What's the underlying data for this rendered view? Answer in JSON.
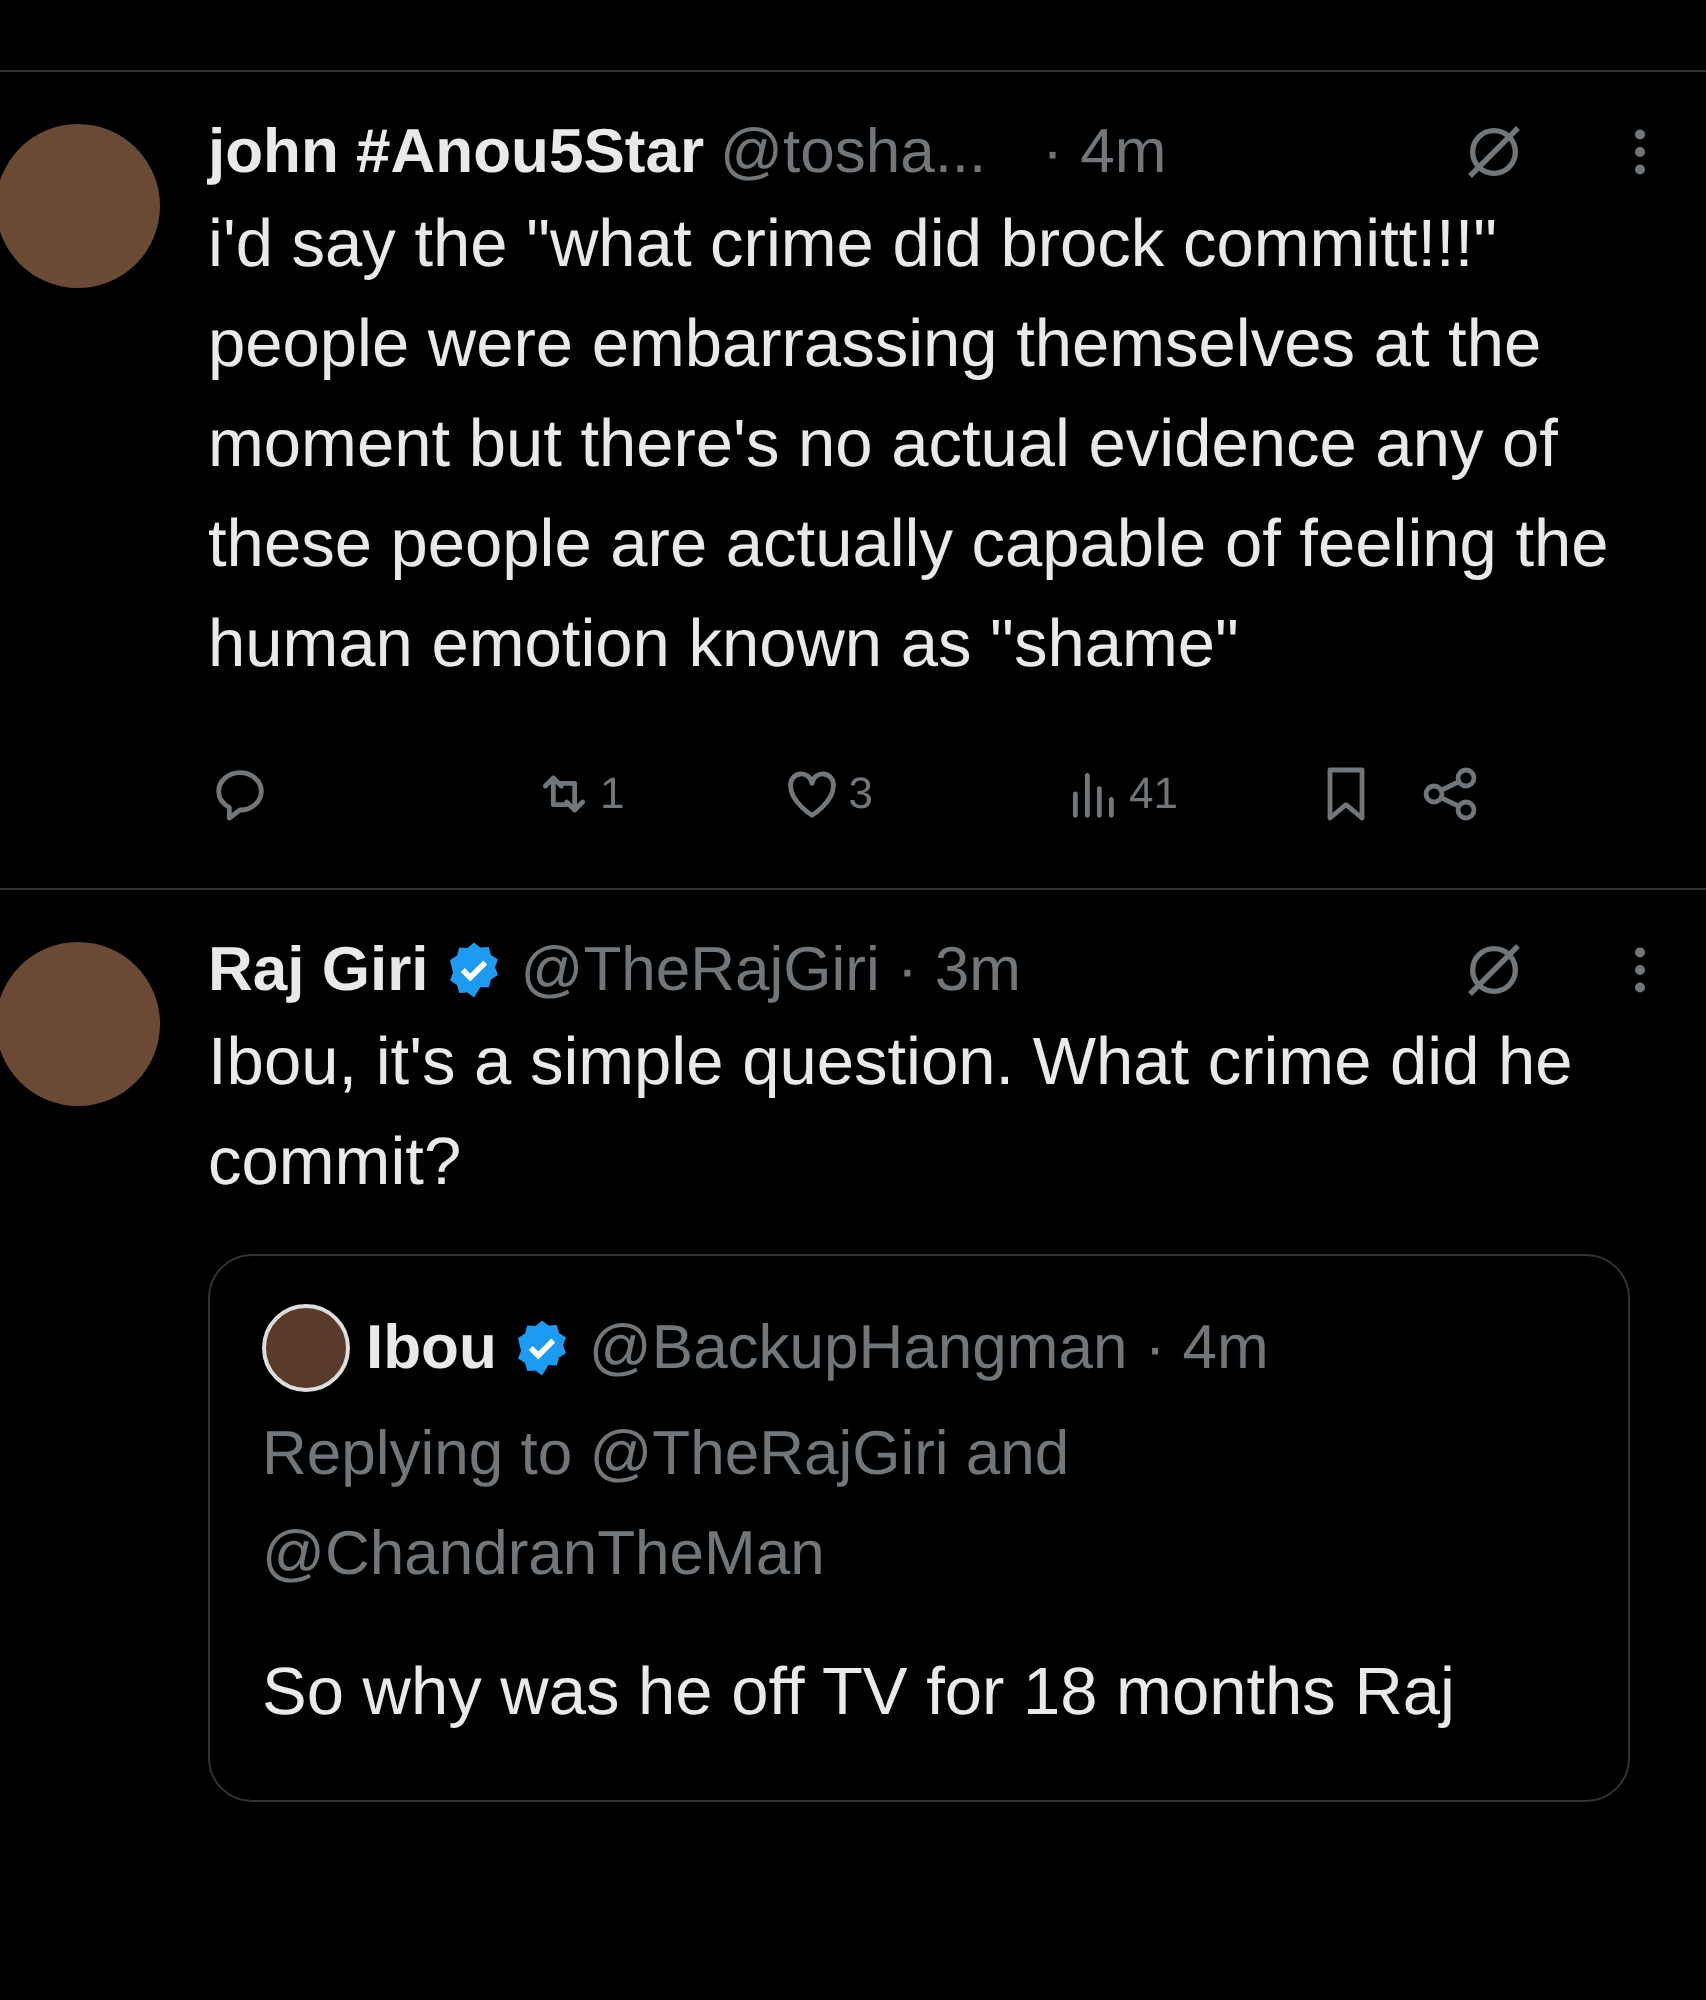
{
  "tweets": [
    {
      "name": "john #Anou5Star",
      "verified": false,
      "handle": "@tosha...",
      "time": "· 4m",
      "text": "i'd say the \"what crime did brock committ!!!\" people were embarrassing themselves at the moment but there's no actual evidence any of these people are actually capable of feeling the human emotion known as \"shame\"",
      "actions": [
        {
          "kind": "reply"
        },
        {
          "kind": "repost",
          "count": "1"
        },
        {
          "kind": "like",
          "count": "3"
        },
        {
          "kind": "views",
          "count": "41"
        },
        {
          "kind": "bookmark"
        },
        {
          "kind": "share"
        }
      ]
    },
    {
      "name": "Raj Giri",
      "verified": true,
      "handle": "@TheRajGiri · 3m",
      "text": "Ibou, it's a simple question. What crime did he commit?",
      "quote": {
        "name": "Ibou",
        "verified": true,
        "handle": "@BackupHangman · 4m",
        "replying_to": "Replying to @TheRajGiri and @ChandranTheMan",
        "text": "So why was he off TV for 18 months Raj"
      }
    }
  ]
}
